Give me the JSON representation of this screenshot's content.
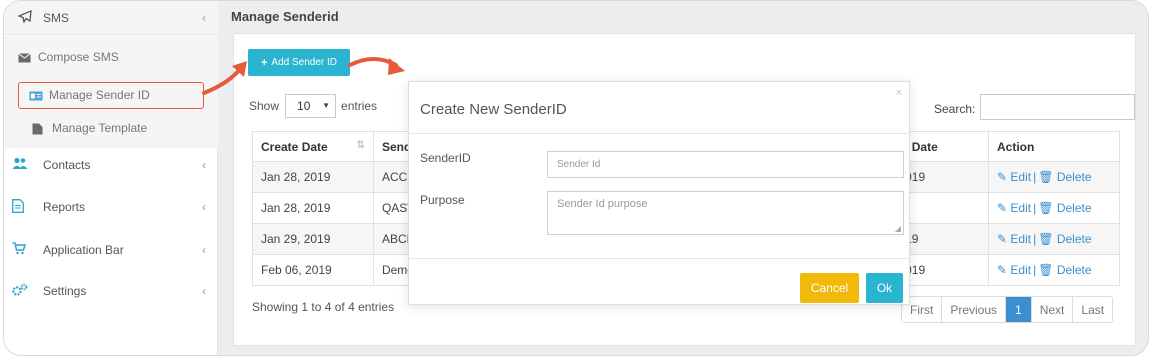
{
  "sidebar": {
    "top": {
      "icon": "paper-plane-icon",
      "label": "SMS",
      "chevron": "‹"
    },
    "submenu": [
      {
        "icon": "envelope-icon",
        "label": "Compose SMS"
      },
      {
        "icon": "id-card-icon",
        "label": "Manage Sender ID"
      },
      {
        "icon": "file-icon",
        "label": "Manage Template"
      }
    ],
    "items": [
      {
        "icon": "users-icon",
        "label": "Contacts",
        "chevron": "‹"
      },
      {
        "icon": "report-icon",
        "label": "Reports",
        "chevron": "‹"
      },
      {
        "icon": "cart-icon",
        "label": "Application Bar",
        "chevron": "‹"
      },
      {
        "icon": "cogs-icon",
        "label": "Settings",
        "chevron": "‹"
      }
    ]
  },
  "header": {
    "title": "Manage Senderid"
  },
  "toolbar": {
    "add_label": "Add Sender ID",
    "add_icon": "+"
  },
  "list_controls": {
    "show_label": "Show",
    "page_size": "10",
    "entries_label": "entries",
    "search_label": "Search:",
    "search_value": ""
  },
  "table": {
    "columns": [
      "Create Date",
      "Send",
      "l Date",
      "Action"
    ],
    "rows": [
      {
        "date": "Jan 28, 2019",
        "sender": "ACCIN",
        "ldate": "019"
      },
      {
        "date": "Jan 28, 2019",
        "sender": "QASW",
        "ldate": ""
      },
      {
        "date": "Jan 29, 2019",
        "sender": "ABCD",
        "ldate": "19"
      },
      {
        "date": "Feb 06, 2019",
        "sender": "Demo",
        "ldate": "019"
      }
    ],
    "edit_label": "Edit",
    "delete_label": "Delete",
    "separator": "|"
  },
  "footer": {
    "showing_text": "Showing 1 to 4 of 4 entries",
    "pager": [
      "First",
      "Previous",
      "1",
      "Next",
      "Last"
    ],
    "active_page": "1"
  },
  "modal": {
    "title": "Create New SenderID",
    "close": "×",
    "fields": [
      {
        "label": "SenderID",
        "placeholder": "Sender Id"
      },
      {
        "label": "Purpose",
        "placeholder": "Sender Id purpose"
      }
    ],
    "cancel_label": "Cancel",
    "ok_label": "Ok"
  },
  "colors": {
    "accent": "#2bb4cf",
    "link": "#3a8fd0",
    "cancel": "#f0b90b",
    "highlight": "#e55b3c"
  }
}
